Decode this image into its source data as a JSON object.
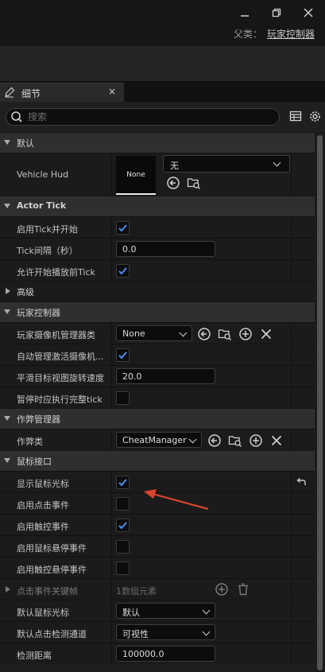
{
  "window": {
    "minimize_icon": "minimize-icon",
    "restore_icon": "restore-icon",
    "close_icon": "close-icon"
  },
  "header": {
    "parent_label": "父类：",
    "parent_value": "玩家控制器"
  },
  "tab": {
    "label": "细节",
    "icon": "pencil-icon",
    "close": "×"
  },
  "search": {
    "placeholder": "搜索"
  },
  "categories": {
    "default": "默认",
    "actor_tick": "Actor Tick",
    "advanced": "高级",
    "player_controller": "玩家控制器",
    "cheat_manager": "作弊管理器",
    "mouse_interface": "鼠标接口"
  },
  "properties": {
    "vehicle_hud": {
      "label": "Vehicle Hud",
      "thumb": "None",
      "value": "无"
    },
    "start_with_tick": {
      "label": "启用Tick并开始",
      "checked": true
    },
    "tick_interval": {
      "label": "Tick间隔（秒）",
      "value": "0.0"
    },
    "tick_before_begin_play": {
      "label": "允许开始播放前Tick",
      "checked": true
    },
    "camera_manager_class": {
      "label": "玩家摄像机管理器类",
      "value": "None"
    },
    "auto_manage_camera": {
      "label": "自动管理激活摄像机...",
      "checked": true
    },
    "smooth_target_rotation": {
      "label": "平滑目标视图旋转速度",
      "value": "20.0"
    },
    "should_tick_paused": {
      "label": "暂停时应执行完整tick",
      "checked": false
    },
    "cheat_class": {
      "label": "作弊类",
      "value": "CheatManager"
    },
    "show_mouse_cursor": {
      "label": "显示鼠标光标",
      "checked": true
    },
    "enable_click_events": {
      "label": "启用点击事件",
      "checked": false
    },
    "enable_touch_events": {
      "label": "启用触控事件",
      "checked": true
    },
    "enable_mouse_over": {
      "label": "启用鼠标悬停事件",
      "checked": false
    },
    "enable_touch_over": {
      "label": "启用触控悬停事件",
      "checked": false
    },
    "click_event_keys": {
      "label": "点击事件关键帧",
      "count": "1数组元素"
    },
    "default_mouse_cursor": {
      "label": "默认鼠标光标",
      "value": "默认"
    },
    "default_click_trace": {
      "label": "默认点击检测通道",
      "value": "可视性"
    },
    "hit_result_trace_distance": {
      "label": "检测距离",
      "value": "100000.0"
    }
  },
  "colors": {
    "accent": "#4a8ef0",
    "annotation_arrow": "#d9442e"
  }
}
